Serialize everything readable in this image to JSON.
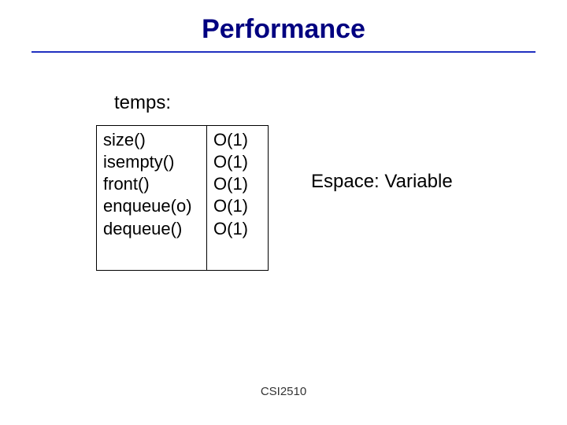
{
  "title": "Performance",
  "temps_label": "temps:",
  "operations": [
    "size()",
    "isempty()",
    "front()",
    "enqueue(o)",
    "dequeue()"
  ],
  "complexities": [
    "O(1)",
    "O(1)",
    "O(1)",
    "O(1)",
    "O(1)"
  ],
  "espace_label": "Espace: Variable",
  "footer": "CSI2510",
  "chart_data": {
    "type": "table",
    "title": "Performance",
    "columns": [
      "operation",
      "time_complexity"
    ],
    "rows": [
      {
        "operation": "size()",
        "time_complexity": "O(1)"
      },
      {
        "operation": "isempty()",
        "time_complexity": "O(1)"
      },
      {
        "operation": "front()",
        "time_complexity": "O(1)"
      },
      {
        "operation": "enqueue(o)",
        "time_complexity": "O(1)"
      },
      {
        "operation": "dequeue()",
        "time_complexity": "O(1)"
      }
    ],
    "space": "Variable"
  }
}
